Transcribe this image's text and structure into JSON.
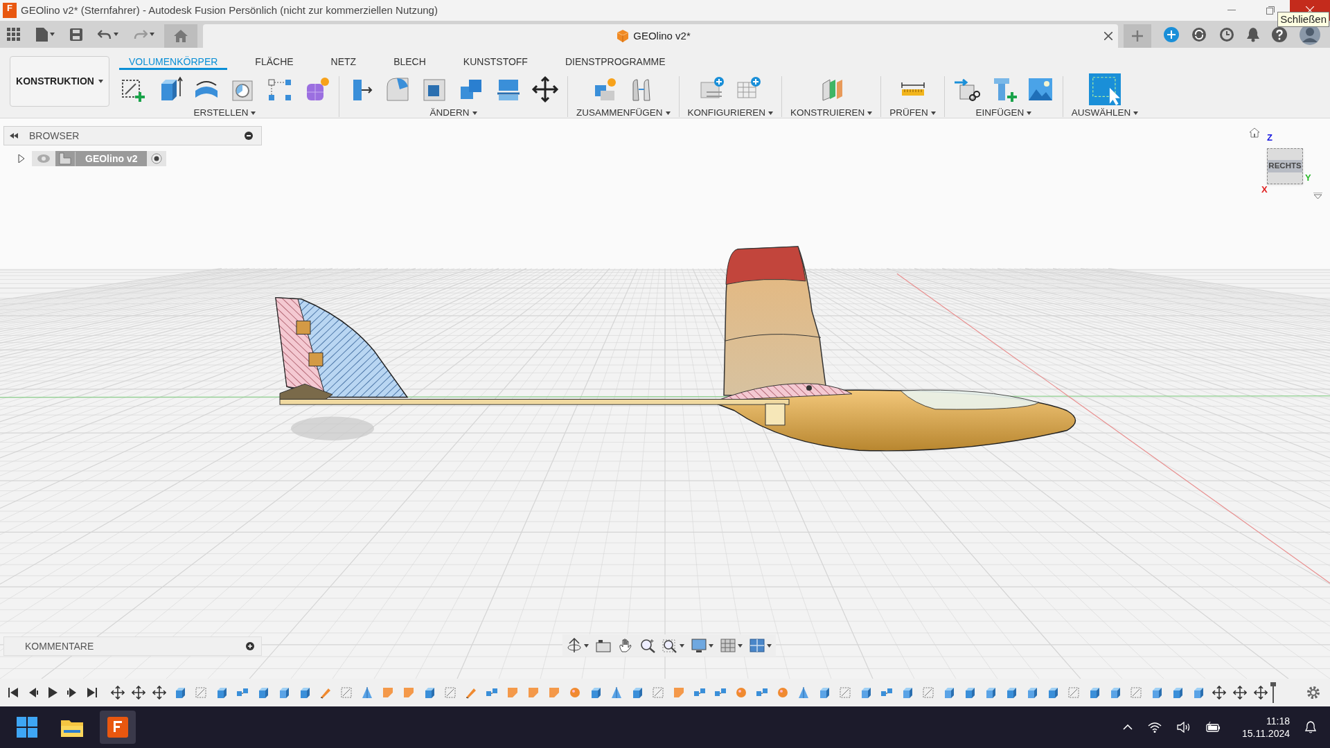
{
  "window": {
    "app_icon": "F",
    "title": "GEOlino v2* (Sternfahrer) - Autodesk Fusion Persönlich (nicht zur kommerziellen Nutzung)",
    "tooltip": "Schließen"
  },
  "document_tab": {
    "title": "GEOlino v2*"
  },
  "workspace": {
    "label": "KONSTRUKTION"
  },
  "tabs": [
    {
      "label": "VOLUMENKÖRPER",
      "selected": true
    },
    {
      "label": "FLÄCHE",
      "selected": false
    },
    {
      "label": "NETZ",
      "selected": false
    },
    {
      "label": "BLECH",
      "selected": false
    },
    {
      "label": "KUNSTSTOFF",
      "selected": false
    },
    {
      "label": "DIENSTPROGRAMME",
      "selected": false
    }
  ],
  "groups": [
    {
      "label": "ERSTELLEN"
    },
    {
      "label": "ÄNDERN"
    },
    {
      "label": "ZUSAMMENFÜGEN"
    },
    {
      "label": "KONFIGURIEREN"
    },
    {
      "label": "KONSTRUIEREN"
    },
    {
      "label": "PRÜFEN"
    },
    {
      "label": "EINFÜGEN"
    },
    {
      "label": "AUSWÄHLEN"
    }
  ],
  "browser": {
    "title": "BROWSER",
    "items": [
      {
        "label": "GEOlino v2",
        "expanded": false
      }
    ]
  },
  "view_cube": {
    "face": "RECHTS",
    "axes": [
      "Z",
      "Y",
      "X"
    ]
  },
  "comments": {
    "title": "KOMMENTARE"
  },
  "taskbar": {
    "time": "11:18",
    "date": "15.11.2024"
  }
}
